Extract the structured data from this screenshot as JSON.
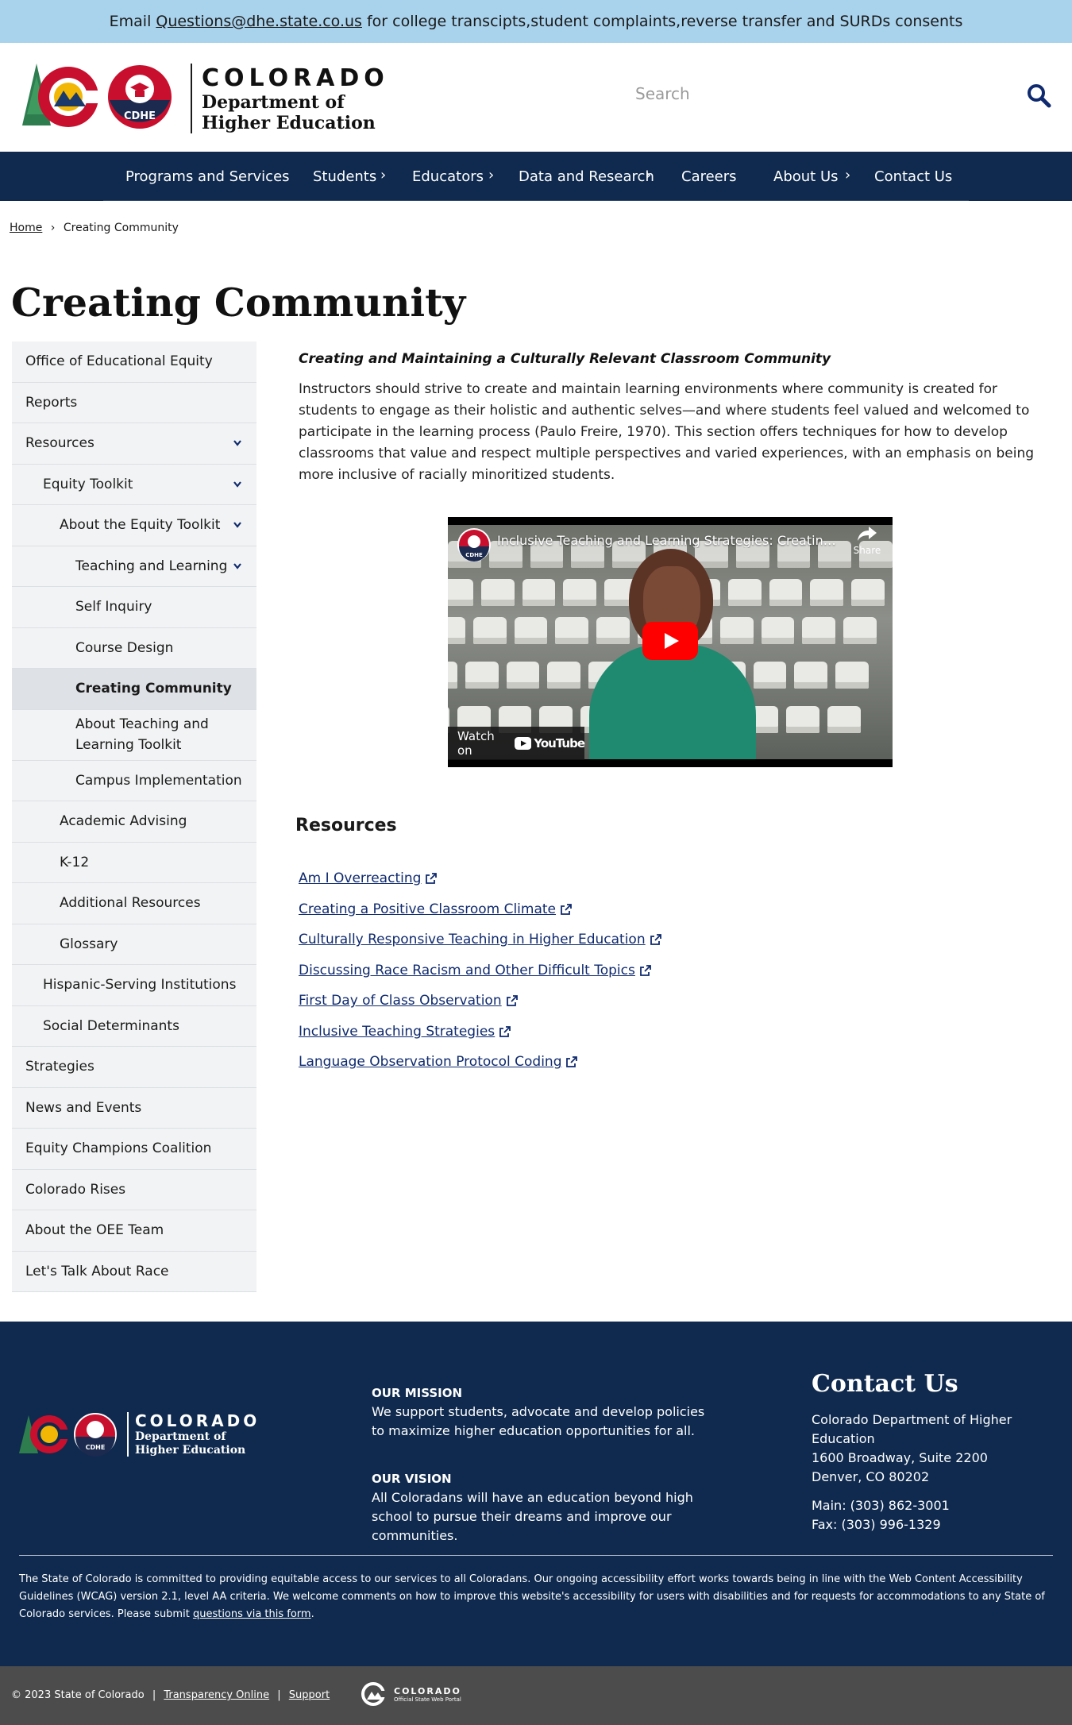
{
  "alert": {
    "prefix": "Email",
    "email": "Questions@dhe.state.co.us",
    "suffix": "for college transcipts,student complaints,reverse transfer and SURDs consents"
  },
  "header": {
    "logo_badge": "CDHE",
    "logo_title": "COLORADO",
    "logo_dept_1": "Department of",
    "logo_dept_2": "Higher Education",
    "search_placeholder": "Search"
  },
  "nav": {
    "items": [
      {
        "label": "Programs and Services",
        "has_submenu": false
      },
      {
        "label": "Students",
        "has_submenu": true
      },
      {
        "label": "Educators",
        "has_submenu": true
      },
      {
        "label": "Data and Research",
        "has_submenu": true
      },
      {
        "label": "Careers",
        "has_submenu": false
      },
      {
        "label": "About Us",
        "has_submenu": true
      },
      {
        "label": "Contact Us",
        "has_submenu": false
      }
    ]
  },
  "breadcrumb": {
    "home": "Home",
    "separator": "›",
    "current": "Creating Community"
  },
  "page_title": "Creating Community",
  "sidebar": {
    "items": [
      {
        "label": "Office of Educational Equity",
        "level": 0,
        "expanded": false
      },
      {
        "label": "Reports",
        "level": 0,
        "expanded": false
      },
      {
        "label": "Resources",
        "level": 0,
        "expanded": true
      },
      {
        "label": "Equity Toolkit",
        "level": 1,
        "expanded": true
      },
      {
        "label": "About the Equity Toolkit",
        "level": 2,
        "expanded": true
      },
      {
        "label": "Teaching and Learning",
        "level": 3,
        "expanded": true
      },
      {
        "label": "Self Inquiry",
        "level": 3,
        "expanded": false
      },
      {
        "label": "Course Design",
        "level": 3,
        "expanded": false
      },
      {
        "label": "Creating Community",
        "level": 3,
        "expanded": false,
        "active": true
      },
      {
        "label": "About Teaching and Learning Toolkit",
        "level": 3,
        "expanded": false
      },
      {
        "label": "Campus Implementation",
        "level": 3,
        "expanded": false
      },
      {
        "label": "Academic Advising",
        "level": 2,
        "expanded": false
      },
      {
        "label": "K-12",
        "level": 2,
        "expanded": false
      },
      {
        "label": "Additional Resources",
        "level": 2,
        "expanded": false
      },
      {
        "label": "Glossary",
        "level": 2,
        "expanded": false
      },
      {
        "label": "Hispanic-Serving Institutions",
        "level": 1,
        "expanded": false
      },
      {
        "label": "Social Determinants",
        "level": 1,
        "expanded": false
      },
      {
        "label": "Strategies",
        "level": 0,
        "expanded": false
      },
      {
        "label": "News and Events",
        "level": 0,
        "expanded": false
      },
      {
        "label": "Equity Champions Coalition",
        "level": 0,
        "expanded": false
      },
      {
        "label": "Colorado Rises",
        "level": 0,
        "expanded": false
      },
      {
        "label": "About the OEE Team",
        "level": 0,
        "expanded": false
      },
      {
        "label": "Let's Talk About Race",
        "level": 0,
        "expanded": false
      }
    ]
  },
  "content": {
    "subheading": "Creating and Maintaining a Culturally Relevant Classroom Community",
    "intro": "Instructors should strive to create and maintain learning environments where community is created for students to engage as their holistic and authentic selves—and where students feel valued and welcomed to participate in the learning process (Paulo Freire, 1970). This section offers techniques for how to develop classrooms that value and respect multiple perspectives and varied experiences, with an emphasis on being more inclusive of racially minoritized students.",
    "video": {
      "title": "Inclusive Teaching and Learning Strategies: Creating Community",
      "channel_badge": "CDHE",
      "share_label": "Share",
      "watch_on": "Watch on",
      "youtube": "YouTube"
    },
    "resources_heading": "Resources",
    "resources": [
      "Am I Overreacting",
      "Creating a Positive Classroom Climate",
      "Culturally Responsive Teaching in Higher Education",
      "Discussing Race Racism and Other Difficult Topics",
      "First Day of Class Observation",
      "Inclusive Teaching Strategies",
      "Language Observation Protocol Coding"
    ]
  },
  "footer": {
    "logo_badge": "CDHE",
    "logo_title": "COLORADO",
    "logo_dept_1": "Department of",
    "logo_dept_2": "Higher Education",
    "mission_title": "OUR MISSION",
    "mission_text": "We support students, advocate and develop policies to maximize higher education opportunities for all.",
    "vision_title": "OUR VISION",
    "vision_text": "All Coloradans will have an education beyond high school to pursue their dreams and improve our communities.",
    "contact_title": "Contact Us",
    "contact_org": "Colorado Department of Higher Education",
    "contact_street": "1600 Broadway, Suite 2200",
    "contact_city": "Denver, CO 80202",
    "contact_main": "Main: (303) 862-3001",
    "contact_fax": "Fax: (303) 996-1329",
    "accessibility_text": "The State of Colorado is committed to providing equitable access to our services to all Coloradans. Our ongoing accessibility effort works towards being in line with the Web Content Accessibility Guidelines (WCAG) version 2.1, level AA criteria. We welcome comments on how to improve this website's accessibility for users with disabilities and for requests for accommodations to any State of Colorado services. Please submit",
    "accessibility_link": "questions via this form",
    "accessibility_end": "."
  },
  "bottom_bar": {
    "copyright": "© 2023 State of Colorado",
    "sep": "|",
    "transparency": "Transparency Online",
    "support": "Support",
    "portal_title": "COLORADO",
    "portal_sub": "Official State Web Portal"
  },
  "colors": {
    "navy": "#0f2a4e",
    "alert_blue": "#a9d2ec",
    "link_blue": "#0f2a6e",
    "sidebar_bg": "#f2f3f4",
    "sidebar_active": "#dee1e6",
    "footer_bottom": "#4c4c4c"
  }
}
